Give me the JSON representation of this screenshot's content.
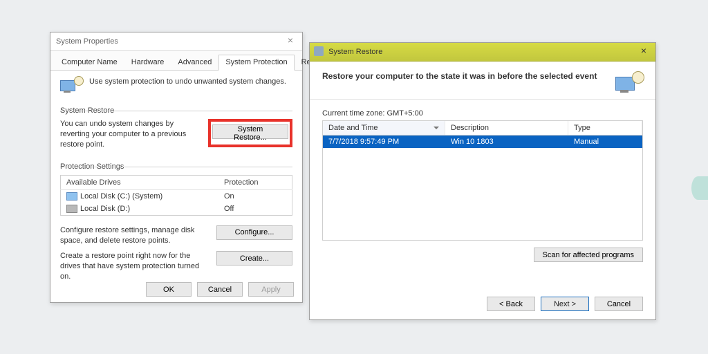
{
  "sysprops": {
    "title": "System Properties",
    "tabs": [
      "Computer Name",
      "Hardware",
      "Advanced",
      "System Protection",
      "Remote"
    ],
    "active_tab": 3,
    "intro": "Use system protection to undo unwanted system changes.",
    "restore_group": {
      "label": "System Restore",
      "text": "You can undo system changes by reverting your computer to a previous restore point.",
      "button": "System Restore..."
    },
    "settings_group": {
      "label": "Protection Settings",
      "columns": [
        "Available Drives",
        "Protection"
      ],
      "drives": [
        {
          "name": "Local Disk (C:) (System)",
          "protection": "On",
          "icon": "c"
        },
        {
          "name": "Local Disk (D:)",
          "protection": "Off",
          "icon": "d"
        }
      ],
      "configure_text": "Configure restore settings, manage disk space, and delete restore points.",
      "configure_btn": "Configure...",
      "create_text": "Create a restore point right now for the drives that have system protection turned on.",
      "create_btn": "Create..."
    },
    "buttons": {
      "ok": "OK",
      "cancel": "Cancel",
      "apply": "Apply"
    }
  },
  "restore": {
    "title": "System Restore",
    "heading": "Restore your computer to the state it was in before the selected event",
    "tz_label": "Current time zone: GMT+5:00",
    "columns": [
      "Date and Time",
      "Description",
      "Type"
    ],
    "rows": [
      {
        "datetime": "7/7/2018 9:57:49 PM",
        "description": "Win 10 1803",
        "type": "Manual",
        "selected": true
      }
    ],
    "scan_btn": "Scan for affected programs",
    "nav": {
      "back": "< Back",
      "next": "Next >",
      "cancel": "Cancel"
    }
  }
}
